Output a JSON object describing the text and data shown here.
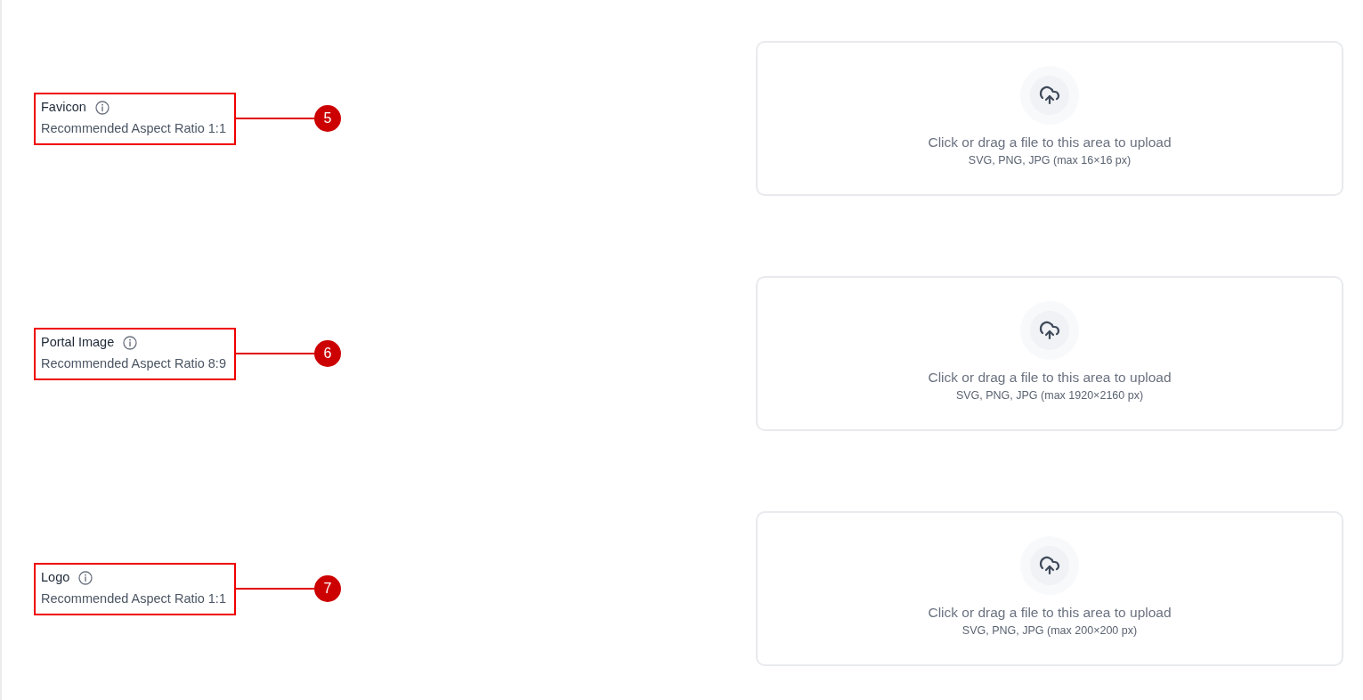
{
  "sections": [
    {
      "label": "Favicon",
      "hint": "Recommended Aspect Ratio 1:1",
      "callout": "5",
      "upload": {
        "prompt": "Click or drag a file to this area to upload",
        "formats": "SVG, PNG, JPG (max 16×16 px)"
      }
    },
    {
      "label": "Portal Image",
      "hint": "Recommended Aspect Ratio 8:9",
      "callout": "6",
      "upload": {
        "prompt": "Click or drag a file to this area to upload",
        "formats": "SVG, PNG, JPG (max 1920×2160 px)"
      }
    },
    {
      "label": "Logo",
      "hint": "Recommended Aspect Ratio 1:1",
      "callout": "7",
      "upload": {
        "prompt": "Click or drag a file to this area to upload",
        "formats": "SVG, PNG, JPG (max 200×200 px)"
      }
    }
  ]
}
